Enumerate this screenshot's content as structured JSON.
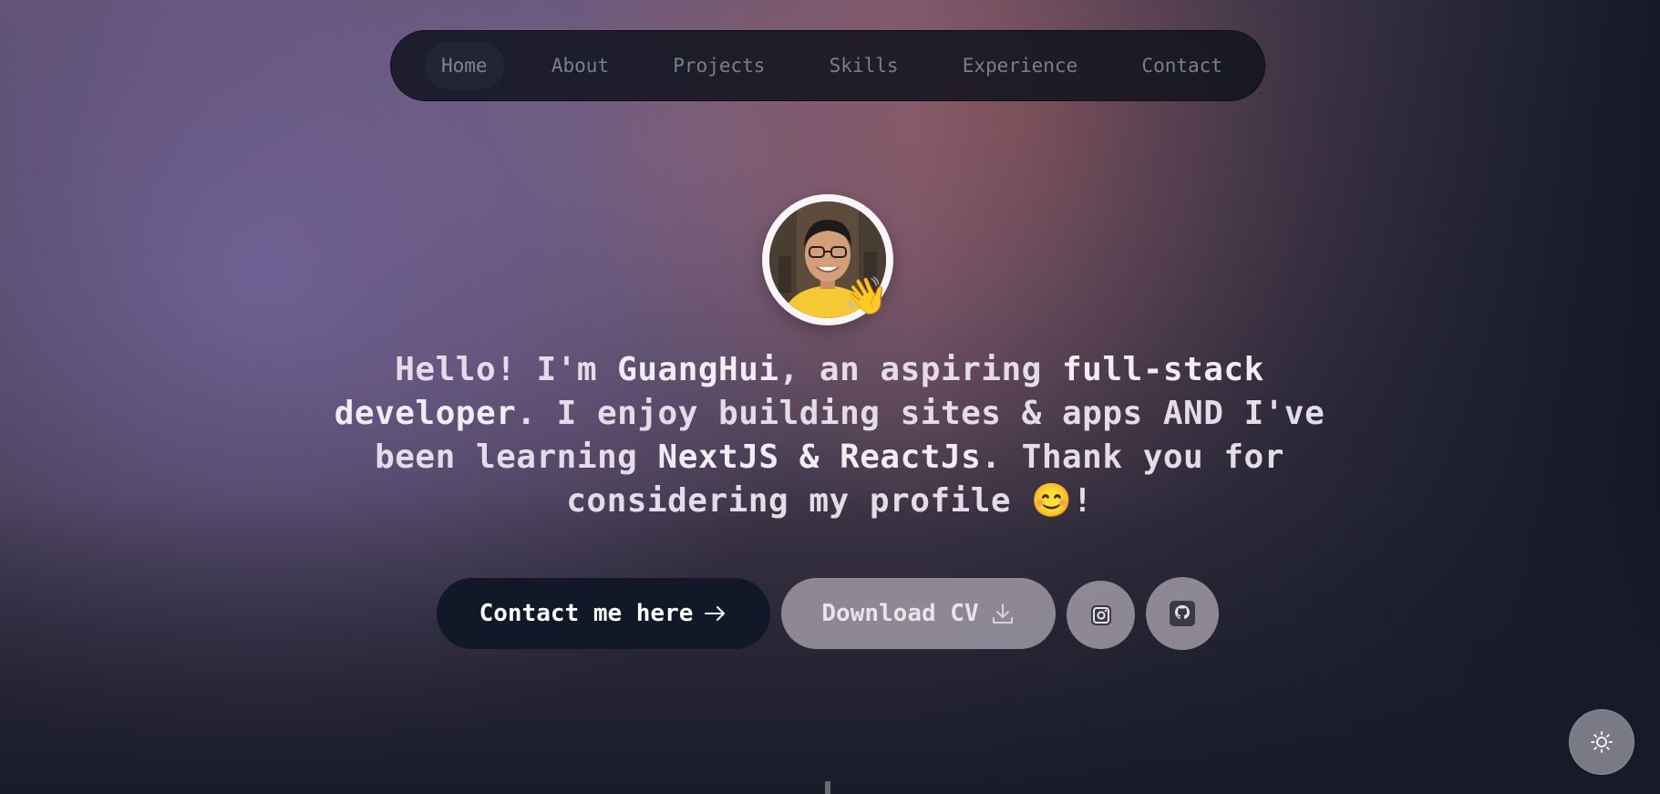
{
  "nav": {
    "items": [
      {
        "label": "Home",
        "active": true
      },
      {
        "label": "About"
      },
      {
        "label": "Projects"
      },
      {
        "label": "Skills"
      },
      {
        "label": "Experience"
      },
      {
        "label": "Contact"
      }
    ]
  },
  "hero": {
    "wave_emoji": "👋",
    "intro_1": "Hello! I'm ",
    "name": "GuangHui",
    "intro_2": ", an aspiring ",
    "role": "full-stack developer",
    "intro_3": ". I enjoy building sites & apps AND I've been learning ",
    "tech": "NextJS & ReactJs",
    "intro_4": ". Thank you for considering my profile ",
    "smile_emoji": "😊",
    "intro_5": "!"
  },
  "actions": {
    "contact_label": "Contact me here",
    "contact_icon": "arrow-right-icon",
    "cv_label": "Download CV",
    "cv_icon": "download-icon",
    "instagram_icon": "instagram-icon",
    "github_icon": "github-icon"
  },
  "theme_toggle": {
    "icon": "sun-icon"
  },
  "colors": {
    "nav_bg": "#12141f",
    "nav_text": "#7a7f8c",
    "contact_btn_bg": "#111827",
    "headline_text": "#e4dde8"
  }
}
